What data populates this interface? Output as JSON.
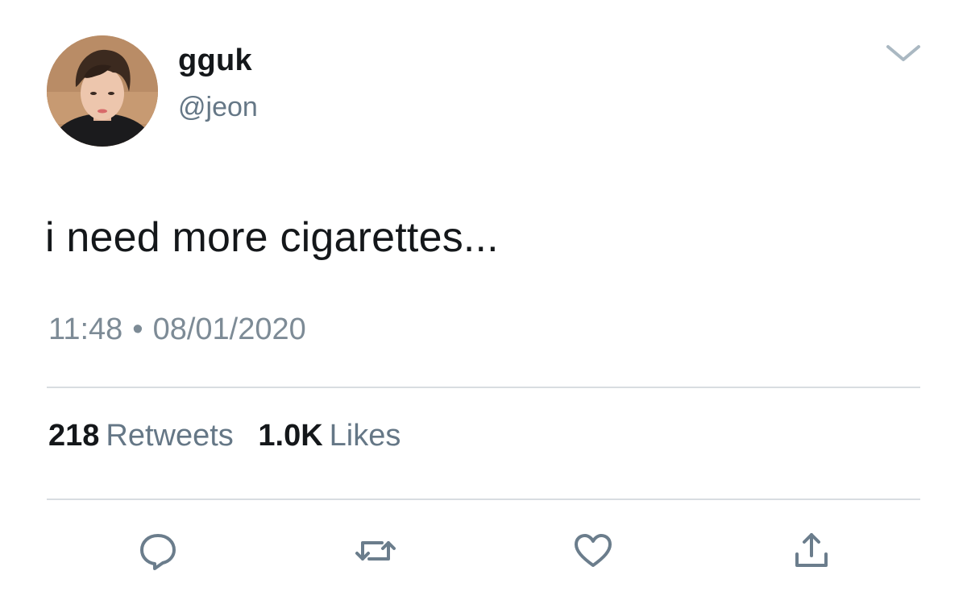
{
  "tweet": {
    "author": {
      "display_name": "gguk",
      "handle": "@jeon"
    },
    "text": "i need more cigarettes...",
    "time": "11:48",
    "separator": "•",
    "date": "08/01/2020",
    "stats": {
      "retweets_count": "218",
      "retweets_label": "Retweets",
      "likes_count": "1.0K",
      "likes_label": "Likes"
    },
    "actions": [
      {
        "icon": "reply-icon"
      },
      {
        "icon": "retweet-icon"
      },
      {
        "icon": "like-icon"
      },
      {
        "icon": "share-icon"
      }
    ]
  },
  "colors": {
    "text_primary": "#14171a",
    "text_secondary": "#657786",
    "divider": "#d8dde1",
    "icon": "#6b7d8c"
  }
}
